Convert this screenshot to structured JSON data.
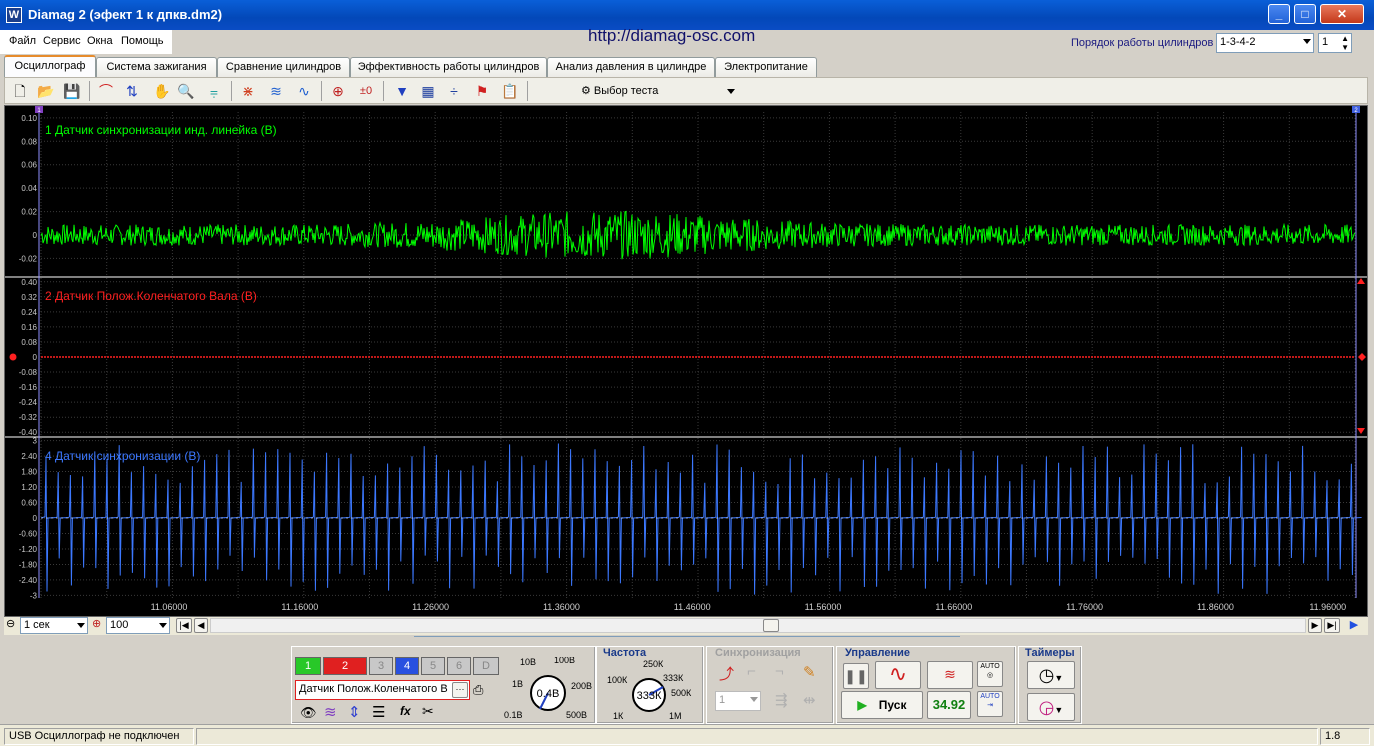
{
  "window": {
    "title": "Diamag 2 (эфект 1 к дпкв.dm2)",
    "app_icon": "W",
    "minimize": "_",
    "maximize": "□",
    "close": "✕"
  },
  "menu": [
    "Файл",
    "Сервис",
    "Окна",
    "Помощь"
  ],
  "url": "http://diamag-osc.com",
  "cylinder_order": {
    "label": "Порядок работы цилиндров",
    "value": "1-3-4-2",
    "spin": "1"
  },
  "tabs": [
    "Осциллограф",
    "Система зажигания",
    "Сравнение цилиндров",
    "Эффективность работы цилиндров",
    "Анализ давления в цилиндре",
    "Электропитание"
  ],
  "active_tab": 0,
  "toolbar": {
    "test_select": "Выбор теста",
    "icons": [
      "new-file-icon",
      "open-folder-icon",
      "save-icon",
      "sync-icon",
      "cursor-icon",
      "hand-icon",
      "zoom-icon",
      "filter-icon",
      "spectrum-icon",
      "overlay-icon",
      "waves-icon",
      "auto-icon",
      "zero-icon",
      "marker-icon",
      "grid-icon",
      "divider-icon",
      "flag-icon",
      "notes-icon"
    ]
  },
  "channels": [
    {
      "label": "1 Датчик синхронизации инд. линейка (В)",
      "color": "#00ff00",
      "ticks": [
        "0.10",
        "0.08",
        "0.06",
        "0.04",
        "0.02",
        "0",
        "-0.02"
      ],
      "range": [
        -0.035,
        0.105
      ]
    },
    {
      "label": "2 Датчик Полож.Коленчатого Вала (В)",
      "color": "#ff2020",
      "ticks": [
        "0.40",
        "0.32",
        "0.24",
        "0.16",
        "0.08",
        "0",
        "-0.08",
        "-0.16",
        "-0.24",
        "-0.32",
        "-0.40"
      ],
      "ticks_all": [
        "0.40",
        "0.32",
        "0.24",
        "0.16",
        "0.08",
        "0",
        "-0.08",
        "-0.16",
        "-0.24",
        "-0.32",
        "-0.40"
      ],
      "range": [
        -0.42,
        0.42
      ]
    },
    {
      "label": "4 Датчик синхронизации (В)",
      "color": "#3c78ff",
      "ticks": [
        "3",
        "2.40",
        "1.80",
        "1.20",
        "0.60",
        "0",
        "-0.60",
        "-1.20",
        "-1.80",
        "-2.40",
        "-3"
      ],
      "range": [
        -3.1,
        3.1
      ]
    }
  ],
  "ch2_ticks": [
    "0.40",
    "0.32",
    "0.24",
    "0.16",
    "0.08",
    "0",
    "-0.08",
    "-0.16",
    "-0.24",
    "-0.32",
    "-0.40"
  ],
  "time_axis": [
    "11.06000",
    "11.16000",
    "11.26000",
    "11.36000",
    "11.46000",
    "11.56000",
    "11.66000",
    "11.76000",
    "11.86000",
    "11.96000"
  ],
  "markers": {
    "left": "1",
    "right": "2"
  },
  "scale": {
    "time": "1 сек",
    "zoom": "100"
  },
  "channel_buttons": [
    {
      "label": "1",
      "color": "#28c828",
      "active": true
    },
    {
      "label": "2",
      "color": "#e02020",
      "active": true
    },
    {
      "label": "3",
      "color": "#c8c8c8",
      "active": false
    },
    {
      "label": "4",
      "color": "#2850e0",
      "active": true
    },
    {
      "label": "5",
      "color": "#c8c8c8",
      "active": false
    },
    {
      "label": "6",
      "color": "#c8c8c8",
      "active": false
    },
    {
      "label": "D",
      "color": "#c8c8c8",
      "active": false
    }
  ],
  "selected_channel": "Датчик Полож.Коленчатого В",
  "volt_knob": {
    "value": "0.4В",
    "marks": [
      "10В",
      "100В",
      "1В",
      "200В",
      "0.1В",
      "500В"
    ]
  },
  "freq": {
    "title": "Частота",
    "value": "333К",
    "marks": [
      "250К",
      "100К",
      "333К",
      "500К",
      "1К",
      "1М"
    ]
  },
  "sync": {
    "title": "Синхронизация",
    "channel": "1"
  },
  "control": {
    "title": "Управление",
    "start": "Пуск",
    "counter": "34.92",
    "auto": "AUTO"
  },
  "timers": {
    "title": "Таймеры"
  },
  "status": {
    "text": "USB Осциллограф не подключен",
    "version": "1.8"
  }
}
